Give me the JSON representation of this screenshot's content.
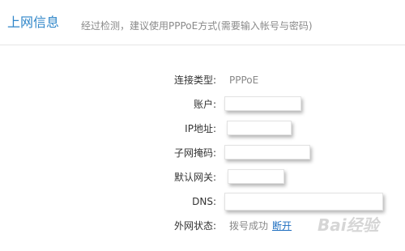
{
  "header": {
    "title": "上网信息",
    "description": "经过检测，建议使用PPPoE方式(需要输入帐号与密码)"
  },
  "info": {
    "connection_type_label": "连接类型:",
    "connection_type_value": "PPPoE",
    "account_label": "账户:",
    "account_value": "",
    "ip_label": "IP地址:",
    "ip_value": "",
    "subnet_label": "子网掩码:",
    "subnet_value": "",
    "gateway_label": "默认网关:",
    "gateway_value": "",
    "dns_label": "DNS:",
    "dns_value": "",
    "wan_status_label": "外网状态:",
    "wan_status_value": "拨号成功",
    "disconnect_link": "断开"
  },
  "watermark": "Bai经验",
  "colors": {
    "title_blue": "#2f86c9",
    "link_blue": "#1f6fc0",
    "muted_text": "#888888"
  }
}
